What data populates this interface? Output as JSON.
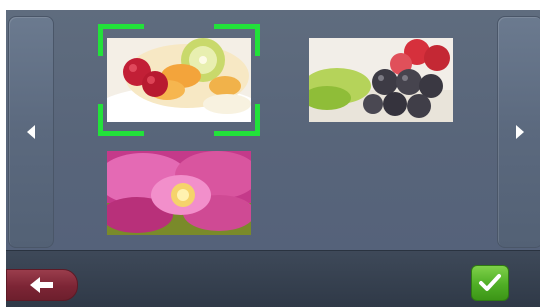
{
  "gallery": {
    "photos": [
      {
        "subject": "fruit-salad-with-kiwi-and-raspberries",
        "selected": true
      },
      {
        "subject": "grapes-and-tomatoes",
        "selected": false
      },
      {
        "subject": "pink-flower",
        "selected": false
      }
    ],
    "nav": {
      "left_icon": "chevron-left-icon",
      "right_icon": "chevron-right-icon"
    }
  },
  "bottom_bar": {
    "back_icon": "back-arrow-icon",
    "confirm_icon": "checkmark-icon"
  },
  "colors": {
    "selection": "#22e23a",
    "back_button": "#7c2535",
    "confirm_button": "#4fae25",
    "panel": "#5a677b"
  }
}
